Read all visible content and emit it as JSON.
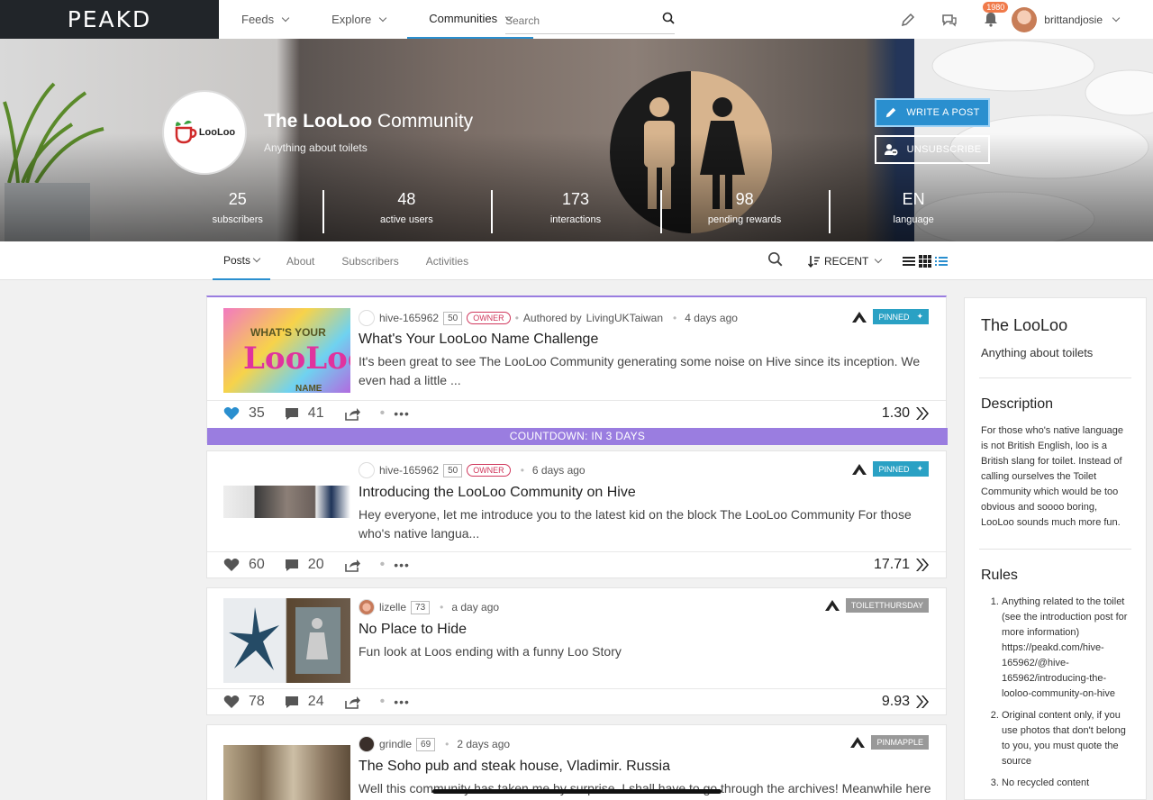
{
  "brand": {
    "logo_text": "PEAKD"
  },
  "nav": {
    "items": [
      {
        "label": "Feeds"
      },
      {
        "label": "Explore"
      },
      {
        "label": "Communities"
      }
    ],
    "search_placeholder": "Search",
    "notifications_count": "1980",
    "username": "brittandjosie"
  },
  "community": {
    "title_bold": "The LooLoo",
    "title_rest": " Community",
    "subtitle": "Anything about toilets",
    "logo_text": "LooLoo",
    "write_post_label": "WRITE A POST",
    "unsubscribe_label": "UNSUBSCRIBE",
    "stats": [
      {
        "value": "25",
        "label": "subscribers"
      },
      {
        "value": "48",
        "label": "active users"
      },
      {
        "value": "173",
        "label": "interactions"
      },
      {
        "value": "98",
        "label": "pending rewards"
      },
      {
        "value": "EN",
        "label": "language"
      }
    ]
  },
  "subnav": {
    "tabs": [
      {
        "label": "Posts"
      },
      {
        "label": "About"
      },
      {
        "label": "Subscribers"
      },
      {
        "label": "Activities"
      }
    ],
    "sort_label": "RECENT"
  },
  "posts": [
    {
      "author": "hive-165962",
      "rep": "50",
      "role": "OWNER",
      "authored_by_prefix": "Authored by",
      "authored_by": "LivingUKTaiwan",
      "time": "4 days ago",
      "tag": "PINNED",
      "title": "What's Your LooLoo Name Challenge",
      "excerpt": "It's been great to see The LooLoo Community generating some noise on Hive since its inception. We even had a little ...",
      "thumb_text_top": "WHAT'S YOUR",
      "thumb_text_big": "LooLoo",
      "thumb_text_bottom": "NAME",
      "votes": "35",
      "comments": "41",
      "payout": "1.30",
      "countdown": "COUNTDOWN: IN 3 DAYS"
    },
    {
      "author": "hive-165962",
      "rep": "50",
      "role": "OWNER",
      "time": "6 days ago",
      "tag": "PINNED",
      "title": "Introducing the LooLoo Community on Hive",
      "excerpt": "Hey everyone, let me introduce you to the latest kid on the block The LooLoo Community For those who's native langua...",
      "votes": "60",
      "comments": "20",
      "payout": "17.71"
    },
    {
      "author": "lizelle",
      "rep": "73",
      "time": "a day ago",
      "tag": "TOILETTHURSDAY",
      "title": "No Place to Hide",
      "excerpt": "Fun look at Loos ending with a funny Loo Story",
      "votes": "78",
      "comments": "24",
      "payout": "9.93"
    },
    {
      "author": "grindle",
      "rep": "69",
      "time": "2 days ago",
      "tag": "PINMAPPLE",
      "title": "The Soho pub and steak house, Vladimir. Russia",
      "excerpt": "Well this community has taken me by surprise. I shall have to go through the archives! Meanwhile here"
    }
  ],
  "sidebar": {
    "title": "The LooLoo",
    "subtitle": "Anything about toilets",
    "description_heading": "Description",
    "description": "For those who's native language is not British English, loo is a British slang for toilet. Instead of calling ourselves the Toilet Community which would be too obvious and soooo boring, LooLoo sounds much more fun.",
    "rules_heading": "Rules",
    "rules": [
      "Anything related to the toilet (see the introduction post for more information) https://peakd.com/hive-165962/@hive-165962/introducing-the-looloo-community-on-hive",
      "Original content only, if you use photos that don't belong to you, you must quote the source",
      "No recycled content"
    ]
  },
  "colors": {
    "accent": "#2a8fcf",
    "owner": "#d0385d",
    "countdown": "#9a7de0",
    "pinned": "#2aa1c4",
    "tag_gray": "#999999",
    "notification": "#f07a4a"
  }
}
